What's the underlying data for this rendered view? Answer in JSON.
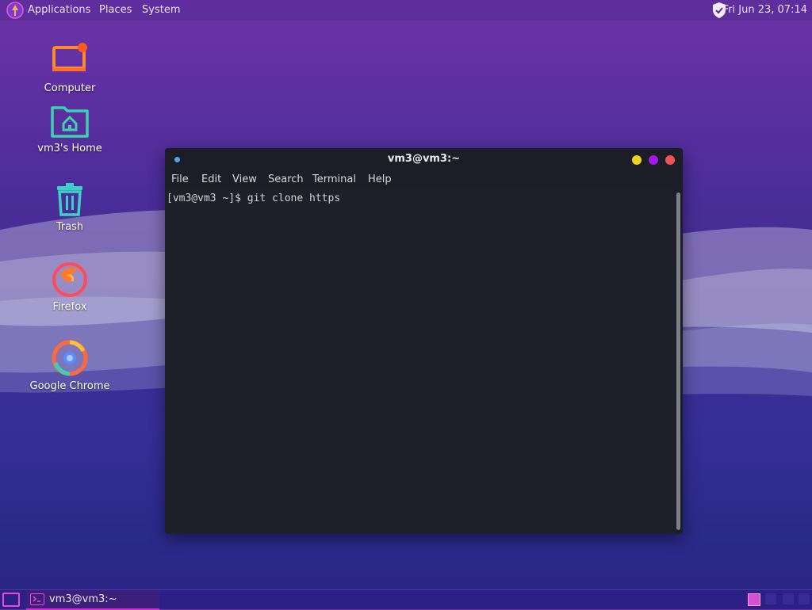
{
  "top_panel": {
    "applications_label": "Applications",
    "places_label": "Places",
    "system_label": "System",
    "clock": "Fri Jun 23, 07:14"
  },
  "desktop_icons": [
    {
      "label": "Computer",
      "icon": "computer-icon"
    },
    {
      "label": "vm3's Home",
      "icon": "home-folder-icon"
    },
    {
      "label": "Trash",
      "icon": "trash-icon"
    },
    {
      "label": "Firefox",
      "icon": "firefox-icon"
    },
    {
      "label": "Google Chrome",
      "icon": "chrome-icon"
    }
  ],
  "terminal": {
    "title": "vm3@vm3:~",
    "menu": [
      "File",
      "Edit",
      "View",
      "Search",
      "Terminal",
      "Help"
    ],
    "lines": [
      "[vm3@vm3 ~]$ git clone https"
    ],
    "window_button_colors": {
      "minimize": "#f3d21b",
      "maximize": "#a418e8",
      "close": "#f05454"
    }
  },
  "taskbar": {
    "tasks": [
      {
        "label": "vm3@vm3:~",
        "icon": "terminal-icon"
      }
    ]
  },
  "colors": {
    "accent": "#d02fd3",
    "panel": "#2c1f86"
  }
}
